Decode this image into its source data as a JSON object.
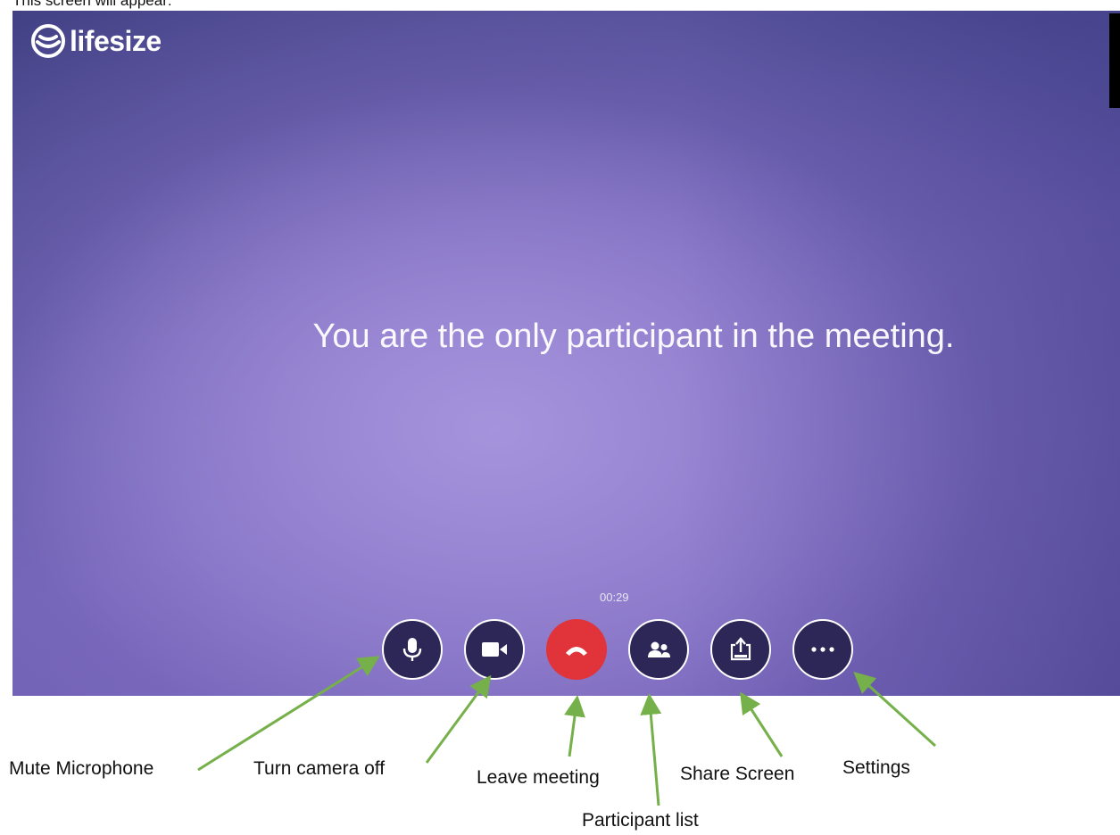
{
  "intro_text": "This screen will appear:",
  "app": {
    "logo_text": "lifesize",
    "logo_icon": "lifesize-logo-icon"
  },
  "meeting": {
    "message": "You are the only participant in the meeting.",
    "timer": "00:29"
  },
  "controls": [
    {
      "name": "mute-microphone-button",
      "icon": "microphone-icon"
    },
    {
      "name": "turn-camera-off-button",
      "icon": "video-camera-icon"
    },
    {
      "name": "leave-meeting-button",
      "icon": "hang-up-phone-icon"
    },
    {
      "name": "participant-list-button",
      "icon": "participants-icon"
    },
    {
      "name": "share-screen-button",
      "icon": "share-screen-icon"
    },
    {
      "name": "settings-button",
      "icon": "more-dots-icon"
    }
  ],
  "annotations": {
    "mute_microphone": "Mute Microphone",
    "turn_camera_off": "Turn camera off",
    "leave_meeting": "Leave meeting",
    "participant_list": "Participant list",
    "share_screen": "Share Screen",
    "settings": "Settings"
  },
  "colors": {
    "background_purple": "#6a5eb1",
    "control_dark": "#2d2758",
    "hangup_red": "#e0333a",
    "annotation_arrow_green": "#76b04a"
  }
}
